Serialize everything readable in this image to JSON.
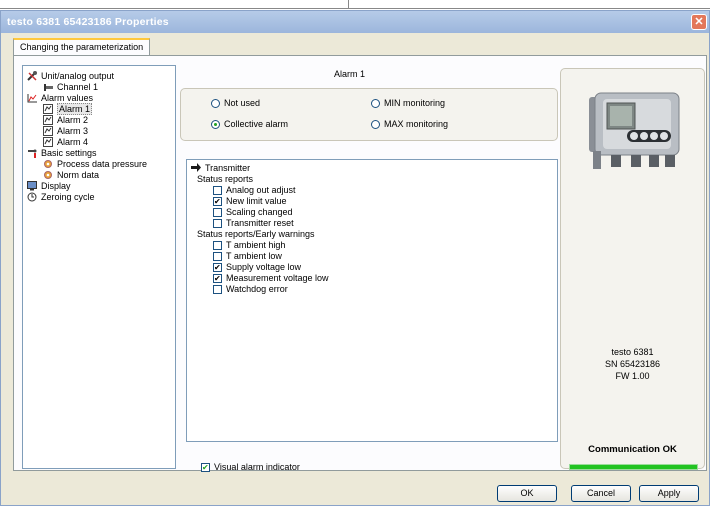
{
  "window": {
    "title": "testo 6381  65423186 Properties",
    "close_glyph": "✕"
  },
  "tabs": [
    {
      "label": "Changing the parameterization",
      "selected": true
    }
  ],
  "tree": {
    "items": [
      {
        "label": "Unit/analog output",
        "icon": "tools-icon",
        "level": 0
      },
      {
        "label": "Channel 1",
        "icon": "channel-icon",
        "level": 1
      },
      {
        "label": "Alarm values",
        "icon": "alarm-chart-icon",
        "level": 0
      },
      {
        "label": "Alarm 1",
        "icon": "alarm-item-icon",
        "level": 1,
        "selected": true
      },
      {
        "label": "Alarm 2",
        "icon": "alarm-item-icon",
        "level": 1
      },
      {
        "label": "Alarm 3",
        "icon": "alarm-item-icon",
        "level": 1
      },
      {
        "label": "Alarm 4",
        "icon": "alarm-item-icon",
        "level": 1
      },
      {
        "label": "Basic settings",
        "icon": "settings-icon",
        "level": 0
      },
      {
        "label": "Process data pressure",
        "icon": "gear-icon",
        "level": 1
      },
      {
        "label": "Norm data",
        "icon": "gear-icon",
        "level": 1
      },
      {
        "label": "Display",
        "icon": "display-icon",
        "level": 0
      },
      {
        "label": "Zeroing cycle",
        "icon": "clock-icon",
        "level": 0
      }
    ]
  },
  "alarm": {
    "heading": "Alarm 1",
    "radios": [
      {
        "label": "Not used",
        "checked": false
      },
      {
        "label": "MIN monitoring",
        "checked": false
      },
      {
        "label": "Collective alarm",
        "checked": true
      },
      {
        "label": "MAX monitoring",
        "checked": false
      }
    ]
  },
  "list": {
    "root_label": "Transmitter",
    "groups": [
      {
        "label": "Status reports",
        "items": [
          {
            "label": "Analog out adjust",
            "checked": false
          },
          {
            "label": "New limit value",
            "checked": true
          },
          {
            "label": "Scaling changed",
            "checked": false
          },
          {
            "label": "Transmitter reset",
            "checked": false
          }
        ]
      },
      {
        "label": "Status reports/Early warnings",
        "items": [
          {
            "label": "T ambient high",
            "checked": false
          },
          {
            "label": "T ambient low",
            "checked": false
          },
          {
            "label": "Supply voltage low",
            "checked": true
          },
          {
            "label": "Measurement voltage low",
            "checked": true
          },
          {
            "label": "Watchdog error",
            "checked": false
          }
        ]
      }
    ]
  },
  "visual_alarm": {
    "label": "Visual alarm indicator",
    "checked": true
  },
  "device": {
    "model": "testo 6381",
    "serial": "SN 65423186",
    "firmware": "FW  1.00",
    "status": "Communication OK",
    "status_color": "#21c321"
  },
  "buttons": {
    "ok": "OK",
    "cancel": "Cancel",
    "apply": "Apply"
  },
  "colors": {
    "titlebar": "#9cb6dc",
    "tab_highlight": "#ffc83c",
    "window_bg": "#ece9d8"
  }
}
